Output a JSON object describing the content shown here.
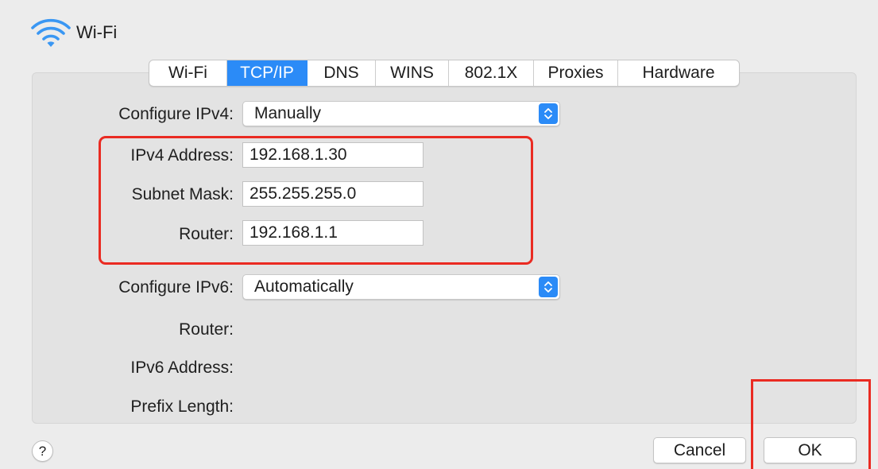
{
  "window": {
    "title": "Wi-Fi",
    "icon": "wifi-icon"
  },
  "tabs": [
    {
      "label": "Wi-Fi",
      "active": false
    },
    {
      "label": "TCP/IP",
      "active": true
    },
    {
      "label": "DNS",
      "active": false
    },
    {
      "label": "WINS",
      "active": false
    },
    {
      "label": "802.1X",
      "active": false
    },
    {
      "label": "Proxies",
      "active": false
    },
    {
      "label": "Hardware",
      "active": false
    }
  ],
  "ipv4": {
    "configure_label": "Configure IPv4:",
    "configure_value": "Manually",
    "address_label": "IPv4 Address:",
    "address_value": "192.168.1.30",
    "subnet_label": "Subnet Mask:",
    "subnet_value": "255.255.255.0",
    "router_label": "Router:",
    "router_value": "192.168.1.1"
  },
  "ipv6": {
    "configure_label": "Configure IPv6:",
    "configure_value": "Automatically",
    "router_label": "Router:",
    "address_label": "IPv6 Address:",
    "prefix_label": "Prefix Length:"
  },
  "buttons": {
    "help": "?",
    "cancel": "Cancel",
    "ok": "OK"
  },
  "colors": {
    "accent": "#2b8bf7",
    "highlight": "#ea2b22",
    "wifi_icon": "#3a97f3"
  }
}
